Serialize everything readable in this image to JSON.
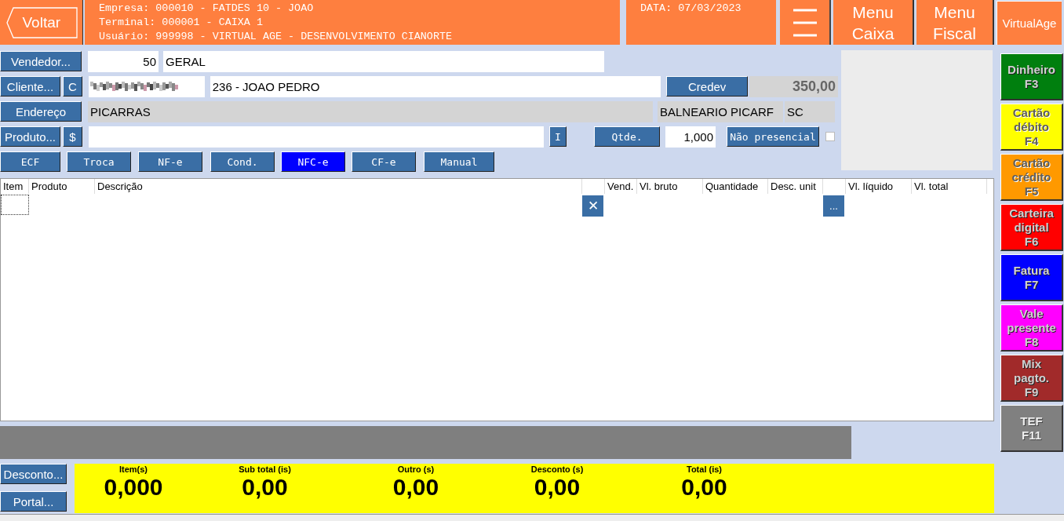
{
  "header": {
    "back_button": "Voltar",
    "info_lines": [
      "Empresa: 000010 - FATDES 10 - JOAO",
      "Terminal: 000001 - CAIXA 1",
      "Usuário: 999998 - VIRTUAL AGE - DESENVOLVIMENTO CIANORTE"
    ],
    "date": "DATA: 07/03/2023",
    "menu_buttons": [
      "Menu\nCaixa",
      "Menu\nFiscal"
    ],
    "brand_button": "VirtualAge"
  },
  "form": {
    "vendedor_button": "Vendedor...",
    "vendedor_code": "50",
    "vendedor_name": "GERAL",
    "cliente_button": "Cliente...",
    "cliente_c_button": "C",
    "cliente_name": "236 - JOAO PEDRO",
    "credev_button": "Credev",
    "credev_value": "350,00",
    "endereco_button": "Endereço",
    "address": "PICARRAS",
    "city": "BALNEARIO PICARF",
    "state": "SC",
    "produto_button": "Produto...",
    "price_button": "$",
    "i_button": "I",
    "qtde_button": "Qtde.",
    "qtde_value": "1,000",
    "nao_presencial_button": "Não presencial",
    "nao_presencial_checked": false
  },
  "modes": [
    {
      "label": "ECF",
      "selected": false
    },
    {
      "label": "Troca",
      "selected": false
    },
    {
      "label": "NF-e",
      "selected": false
    },
    {
      "label": "Cond.",
      "selected": false
    },
    {
      "label": "NFC-e",
      "selected": true
    },
    {
      "label": "CF-e",
      "selected": false
    },
    {
      "label": "Manual",
      "selected": false
    }
  ],
  "table": {
    "columns": [
      "Item",
      "Produto",
      "Descrição",
      "",
      "Vend.",
      "Vl. bruto",
      "Quantidade",
      "Desc. unit",
      "",
      "Vl. líquido",
      "Vl. total"
    ],
    "delete_button": "✕",
    "more_button": "..."
  },
  "bottom_buttons": [
    "Desconto...",
    "Portal..."
  ],
  "totals": [
    {
      "label": "Item(s)",
      "value": "0,000"
    },
    {
      "label": "Sub total (is)",
      "value": "0,00"
    },
    {
      "label": "Outro (s)",
      "value": "0,00"
    },
    {
      "label": "Desconto (s)",
      "value": "0,00"
    },
    {
      "label": "Total (is)",
      "value": "0,00"
    }
  ],
  "payments": [
    {
      "label": "Dinheiro\nF3",
      "color": "#007f0e",
      "disabled": false
    },
    {
      "label": "Cartão\ndébito\nF4",
      "color": "#ffff00",
      "disabled": false
    },
    {
      "label": "Cartão\ncrédito\nF5",
      "color": "#ff9900",
      "disabled": false
    },
    {
      "label": "Carteira\ndigital\nF6",
      "color": "#ff0000",
      "disabled": false
    },
    {
      "label": "Fatura\nF7",
      "color": "#0000ff",
      "disabled": false
    },
    {
      "label": "Vale\npresente\nF8",
      "color": "#ff00ff",
      "disabled": false
    },
    {
      "label": "Mix\npagto.\nF9",
      "color": "#a12a2a",
      "disabled": false
    },
    {
      "label": "TEF\nF11",
      "color": "#808080",
      "disabled": true
    }
  ]
}
